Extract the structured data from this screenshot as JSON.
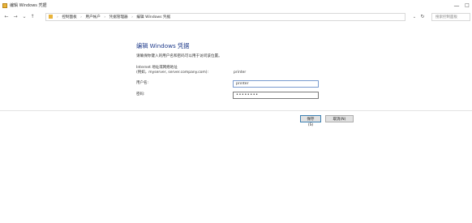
{
  "window": {
    "title": "编辑 Windows 凭据",
    "minimize_glyph": "—",
    "maximize_glyph": "□"
  },
  "nav": {
    "back_glyph": "←",
    "forward_glyph": "→",
    "recent_glyph": "⌄",
    "up_glyph": "↑",
    "breadcrumb": [
      "控制面板",
      "用户帐户",
      "凭据管理器",
      "编辑 Windows 凭据"
    ],
    "separator": "›",
    "dropdown_glyph": "⌄",
    "refresh_glyph": "↻",
    "search_placeholder": "搜索控制面板"
  },
  "form": {
    "heading": "编辑 Windows 凭据",
    "description": "请确保你键入的用户名和密码可以用于访问该位置。",
    "address_label_line1": "Internet 地址或网络地址",
    "address_label_line2": "(例如，myserver, server.company.com):",
    "address_value": "printer",
    "username_label": "用户名:",
    "username_value": "printer",
    "password_label": "密码:",
    "password_value": "••••••••",
    "save_label": "保存(S)",
    "cancel_label": "取消(N)"
  },
  "icons": {
    "folder_color": "#e8b33a"
  }
}
